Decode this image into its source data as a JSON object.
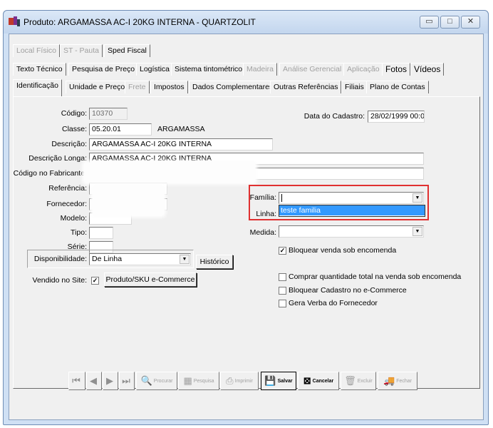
{
  "window": {
    "title": "Produto: ARGAMASSA AC-I 20KG INTERNA - QUARTZOLIT",
    "minimize": "▭",
    "maximize": "□",
    "close": "✕"
  },
  "tabs": {
    "row1": [
      "Local Físico",
      "ST - Pauta",
      "Sped Fiscal"
    ],
    "row2": [
      "Texto Técnico",
      "Pesquisa de Preço",
      "Logística",
      "Sistema tintométrico",
      "Madeira",
      "Análise Gerencial",
      "Aplicação",
      "Fotos",
      "Vídeos"
    ],
    "row3": [
      "Identificação",
      "Unidade e Preço",
      "Frete",
      "Impostos",
      "Dados Complementares",
      "Outras Referências",
      "Filiais",
      "Plano de Contas"
    ]
  },
  "form": {
    "codigo_label": "Código:",
    "codigo_value": "10370",
    "classe_label": "Classe:",
    "classe_value": "05.20.01",
    "classe_desc": "ARGAMASSA",
    "descricao_label": "Descrição:",
    "descricao_value": "ARGAMASSA AC-I 20KG INTERNA",
    "desc_longa_label": "Descrição Longa:",
    "desc_longa_value": "ARGAMASSA AC-I 20KG INTERNA",
    "cod_fabricante_label": "Código no Fabricante:",
    "referencia_label": "Referência:",
    "fornecedor_label": "Fornecedor:",
    "modelo_label": "Modelo:",
    "tipo_label": "Tipo:",
    "serie_label": "Série:",
    "disponibilidade_label": "Disponibilidade:",
    "disponibilidade_value": "De Linha",
    "historico_button": "Histórico",
    "vendido_site_label": "Vendido no Site:",
    "produto_sku_button": "Produto/SKU e-Commerce",
    "data_cadastro_label": "Data do Cadastro:",
    "data_cadastro_value": "28/02/1999 00:0",
    "familia_label": "Família:",
    "familia_option": "teste familia",
    "linha_label": "Linha:",
    "medida_label": "Medida:",
    "checks": {
      "bloquear_venda": "Bloquear venda sob encomenda",
      "comprar_total": "Comprar quantidade total na venda sob encomenda",
      "bloquear_cadastro": "Bloquear Cadastro no e-Commerce",
      "gera_verba": "Gera Verba do Fornecedor"
    }
  },
  "toolbar": {
    "procurar": "Procurar",
    "pesquisa": "Pesquisa",
    "imprimir": "Imprimir",
    "salvar": "Salvar",
    "cancelar": "Cancelar",
    "excluir": "Excluir",
    "fechar": "Fechar"
  },
  "colors": {
    "highlight_border": "#e03030",
    "selection": "#3399ff"
  }
}
